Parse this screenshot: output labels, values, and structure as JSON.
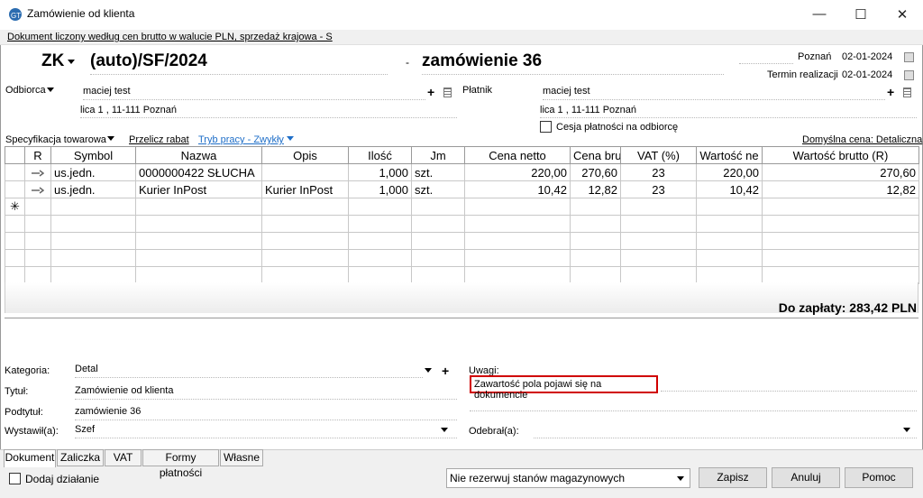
{
  "window": {
    "title": "Zamówienie od klienta",
    "subtitle": "Dokument liczony według cen brutto w walucie PLN, sprzedaż krajowa - S",
    "minimize": "—",
    "maximize": "☐",
    "close": "✕"
  },
  "header": {
    "doc_type": "ZK",
    "doc_number": "(auto)/SF/2024",
    "dash": "-",
    "doc_name": "zamówienie 36",
    "city": "Poznań",
    "date": "02-01-2024",
    "realization_label": "Termin realizacji",
    "realization_date": "02-01-2024"
  },
  "recipient": {
    "label": "Odbiorca",
    "name": "maciej test",
    "address": "lica 1 , 11-111 Poznań"
  },
  "payer": {
    "label": "Płatnik",
    "name": "maciej test",
    "address": "lica 1 , 11-111 Poznań",
    "cession_label": "Cesja płatności na odbiorcę"
  },
  "toolbar": {
    "spec_label": "Specyfikacja towarowa",
    "recalc_label": "Przelicz rabat",
    "mode_label": "Tryb pracy - Zwykły",
    "default_price": "Domyślna cena: Detaliczna"
  },
  "table": {
    "columns": [
      "R",
      "Symbol",
      "Nazwa",
      "Opis",
      "Ilość",
      "Jm",
      "Cena netto",
      "Cena bru",
      "VAT (%)",
      "Wartość ne",
      "Wartość brutto (R)"
    ],
    "rows": [
      {
        "symbol": "us.jedn.",
        "name": "0000000422 SŁUCHA",
        "desc": "",
        "qty": "1,000",
        "unit": "szt.",
        "net": "220,00",
        "gross": "270,60",
        "vat": "23",
        "net_value": "220,00",
        "gross_value": "270,60"
      },
      {
        "symbol": "us.jedn.",
        "name": "Kurier InPost",
        "desc": "Kurier InPost",
        "qty": "1,000",
        "unit": "szt.",
        "net": "10,42",
        "gross": "12,82",
        "vat": "23",
        "net_value": "10,42",
        "gross_value": "12,82"
      }
    ],
    "new_row_marker": "✳"
  },
  "total": "Do zapłaty: 283,42 PLN",
  "fields": {
    "category_label": "Kategoria:",
    "category_value": "Detal",
    "title_label": "Tytuł:",
    "title_value": "Zamówienie od klienta",
    "subtitle_label": "Podtytuł:",
    "subtitle_value": "zamówienie 36",
    "issued_label": "Wystawił(a):",
    "issued_value": "Szef",
    "notes_label": "Uwagi:",
    "notes_value": "Zawartość pola pojawi się na dokumencie",
    "received_label": "Odebrał(a):"
  },
  "tabs": [
    "Dokument",
    "Zaliczka",
    "VAT",
    "Formy płatności",
    "Własne"
  ],
  "footer": {
    "add_action_label": "Dodaj działanie",
    "stock_select": "Nie rezerwuj stanów magazynowych",
    "save": "Zapisz",
    "cancel": "Anuluj",
    "help": "Pomoc"
  }
}
